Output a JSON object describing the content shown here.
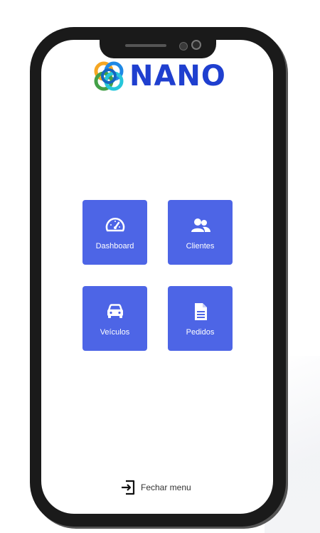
{
  "app": {
    "logo_text": "NANO"
  },
  "menu": {
    "tiles": [
      {
        "label": "Dashboard",
        "icon": "speedometer-icon"
      },
      {
        "label": "Clientes",
        "icon": "users-icon"
      },
      {
        "label": "Veículos",
        "icon": "car-icon"
      },
      {
        "label": "Pedidos",
        "icon": "document-icon"
      }
    ],
    "close_label": "Fechar menu",
    "close_icon": "sign-out-icon"
  },
  "colors": {
    "tile_bg": "#4d65e6",
    "logo_text": "#1f3fcf",
    "frame": "#1a1a1a"
  }
}
